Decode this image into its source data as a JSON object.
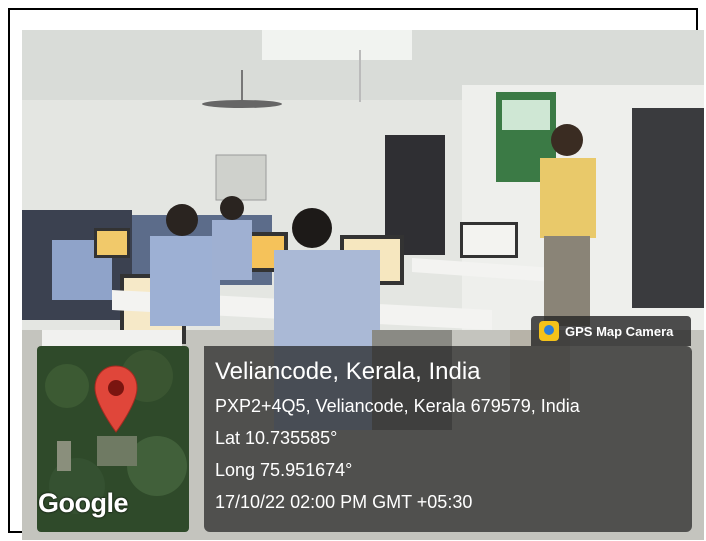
{
  "badge": {
    "icon": "gps-map-camera-icon",
    "label": "GPS Map Camera"
  },
  "location": {
    "title": "Veliancode, Kerala, India",
    "address": "PXP2+4Q5, Veliancode, Kerala 679579, India",
    "lat": "Lat 10.735585°",
    "long": "Long 75.951674°",
    "datetime": "17/10/22 02:00 PM GMT +05:30"
  },
  "map": {
    "icon": "map-pin-icon",
    "provider": "Google"
  }
}
